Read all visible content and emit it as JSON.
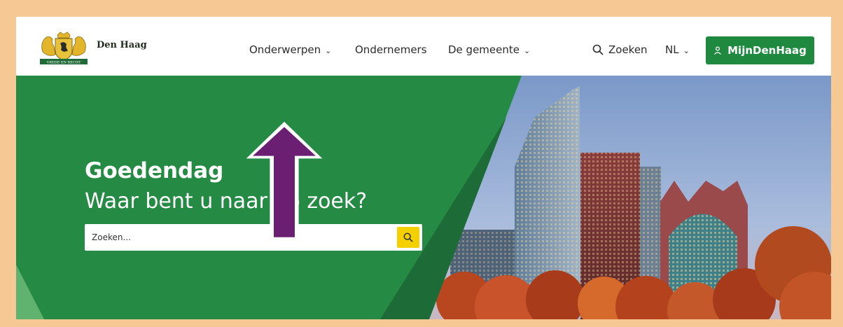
{
  "header": {
    "brand": "Den Haag",
    "logo_banner": "VREDE EN RECHT",
    "nav": [
      {
        "label": "Onderwerpen",
        "has_dropdown": true
      },
      {
        "label": "Ondernemers",
        "has_dropdown": false
      },
      {
        "label": "De gemeente",
        "has_dropdown": true
      }
    ],
    "search_label": "Zoeken",
    "language": "NL",
    "login_button": "MijnDenHaag"
  },
  "hero": {
    "greeting": "Goedendag",
    "question": "Waar bent u naar op zoek?",
    "search_placeholder": "Zoeken..."
  },
  "colors": {
    "green": "#1f8a3f",
    "hero_green": "#258a43",
    "search_yellow": "#f5d000",
    "arrow_purple": "#6b1f73",
    "frame_border": "#f5c894"
  },
  "icons": {
    "search": "search-icon",
    "user": "user-icon",
    "chevron": "chevron-down-icon",
    "annotation": "up-arrow-annotation"
  }
}
